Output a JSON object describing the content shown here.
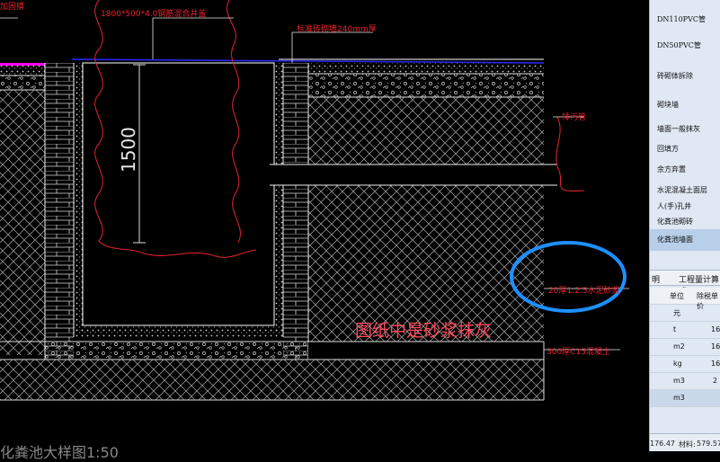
{
  "drawing": {
    "top_left_fragment": "加固摸",
    "label_opening": "1800*500*4.0钢筋混合井盖",
    "label_wall": "标准砖砌墙240mm厚",
    "label_pipe": "排污管",
    "dimension": "1500",
    "label_plaster": "20厚1:2.5水泥砂浆",
    "label_base": "300厚C15混凝土",
    "annotation": "图纸中是砂浆抹灰",
    "bottom_fragment": "化粪池大样图1:50"
  },
  "panel": {
    "items": [
      "DN110PVC管",
      "DN50PVC管",
      "砖砌体拆除",
      "砌块墙",
      "墙面一般抹灰",
      "回填方",
      "余方弃置",
      "水泥混凝土面层",
      "人(手)孔井",
      "化粪池砌砖",
      "化粪池墙面"
    ],
    "selected_index": 10,
    "tabs": [
      "明",
      "工程量计算式"
    ],
    "table_headers": [
      "单位",
      "除税单价"
    ],
    "rows": [
      {
        "unit": "元",
        "price": ""
      },
      {
        "unit": "t",
        "price": "16"
      },
      {
        "unit": "m2",
        "price": "16"
      },
      {
        "unit": "kg",
        "price": "16"
      },
      {
        "unit": "m3",
        "price": "2"
      },
      {
        "unit": "m3",
        "price": ""
      }
    ],
    "status_value": "176.47",
    "status_label": "材料:",
    "status_value2": "579.57"
  },
  "colors": {
    "cad_red": "#e8232e",
    "cad_white": "#ffffff",
    "highlight_circle": "#1e90ff",
    "magenta": "#ff00ff",
    "blue_line": "#2a2aff"
  }
}
